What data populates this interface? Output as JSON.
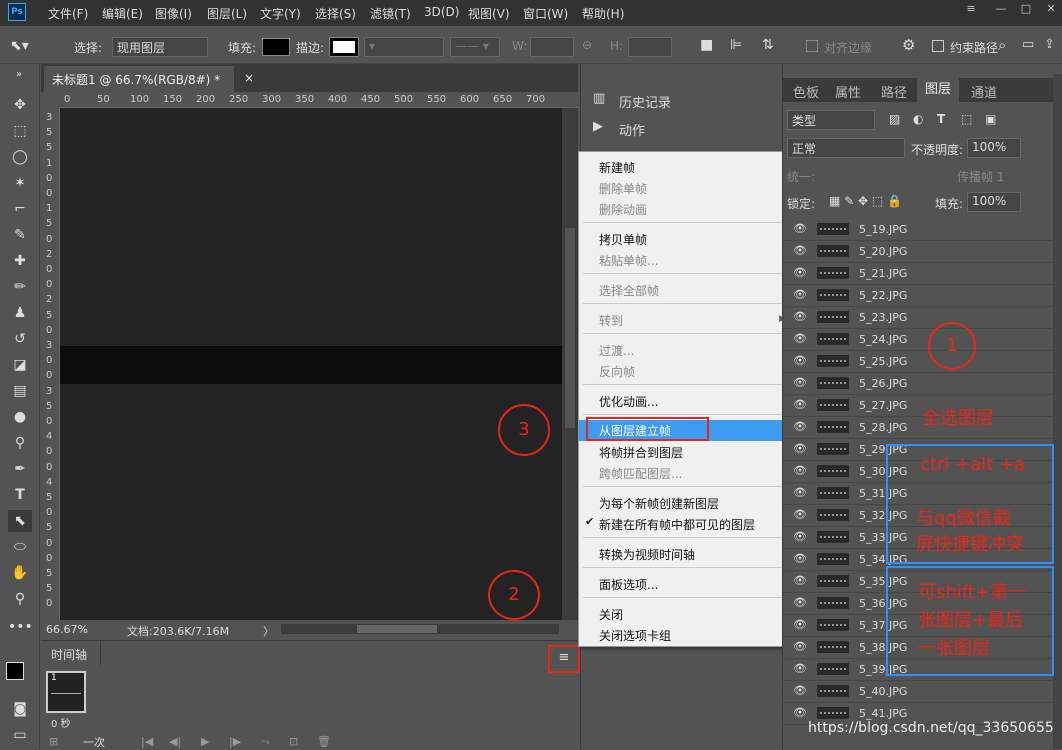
{
  "app": {
    "logo": "Ps"
  },
  "menubar": {
    "items": [
      "文件(F)",
      "编辑(E)",
      "图像(I)",
      "图层(L)",
      "文字(Y)",
      "选择(S)",
      "滤镜(T)",
      "3D(D)",
      "视图(V)",
      "窗口(W)",
      "帮助(H)"
    ]
  },
  "window_controls": {
    "collapse": "≡",
    "minimize": "—",
    "maximize": "□",
    "close": "✕"
  },
  "options": {
    "select_label": "选择:",
    "select_value": "现用图层",
    "fill_label": "填充:",
    "stroke_label": "描边:",
    "w_label": "W:",
    "h_label": "H:",
    "align_edges": "对齐边缘",
    "constrain_path": "约束路径"
  },
  "document": {
    "tab_title": "未标题1 @ 66.7%(RGB/8#) *",
    "close": "×"
  },
  "ruler": {
    "h": [
      "0",
      "50",
      "100",
      "150",
      "200",
      "250",
      "300",
      "350",
      "400",
      "450",
      "500",
      "550",
      "600",
      "650",
      "700"
    ],
    "v": [
      "3",
      "5",
      "5",
      "1",
      "0",
      "0",
      "1",
      "5",
      "0",
      "2",
      "0",
      "0",
      "2",
      "5",
      "0",
      "3",
      "0",
      "0",
      "3",
      "5",
      "0",
      "4",
      "0",
      "0",
      "4",
      "5",
      "0",
      "5",
      "0",
      "0",
      "5",
      "5",
      "0"
    ]
  },
  "status": {
    "zoom": "66.67%",
    "doc": "文档:203.6K/7.16M",
    "arrow": "〉"
  },
  "timeline": {
    "tab": "时间轴",
    "frame_number": "1",
    "frame_delay": "0 秒",
    "loop": "一次"
  },
  "mid_panel": {
    "history": "历史记录",
    "actions": "动作"
  },
  "context_menu": {
    "items": [
      {
        "label": "新建帧",
        "disabled": false
      },
      {
        "label": "删除单帧",
        "disabled": true
      },
      {
        "label": "删除动画",
        "disabled": true
      },
      {
        "label": "拷贝单帧",
        "disabled": false
      },
      {
        "label": "粘贴单帧...",
        "disabled": true
      },
      {
        "label": "选择全部帧",
        "disabled": true
      },
      {
        "label": "转到",
        "disabled": true
      },
      {
        "label": "过渡...",
        "disabled": true
      },
      {
        "label": "反向帧",
        "disabled": true
      },
      {
        "label": "优化动画...",
        "disabled": false
      },
      {
        "label": "从图层建立帧",
        "disabled": false
      },
      {
        "label": "将帧拼合到图层",
        "disabled": false
      },
      {
        "label": "跨帧匹配图层...",
        "disabled": true
      },
      {
        "label": "为每个新帧创建新图层",
        "disabled": false
      },
      {
        "label": "新建在所有帧中都可见的图层",
        "disabled": false
      },
      {
        "label": "转换为视频时间轴",
        "disabled": false
      },
      {
        "label": "面板选项...",
        "disabled": false
      },
      {
        "label": "关闭",
        "disabled": false
      },
      {
        "label": "关闭选项卡组",
        "disabled": false
      }
    ]
  },
  "layers_panel": {
    "tabs": [
      "色板",
      "属性",
      "路径",
      "图层",
      "通道"
    ],
    "active_tab": "图层",
    "filter": "类型",
    "blend_mode": "正常",
    "opacity_label": "不透明度:",
    "opacity": "100%",
    "lock_label": "锁定:",
    "fill_label": "填充:",
    "fill": "100%",
    "propagate": "传播帧 1",
    "unify": "统一:"
  },
  "layers": [
    "5_19.JPG",
    "5_20.JPG",
    "5_21.JPG",
    "5_22.JPG",
    "5_23.JPG",
    "5_24.JPG",
    "5_25.JPG",
    "5_26.JPG",
    "5_27.JPG",
    "5_28.JPG",
    "5_29.JPG",
    "5_30.JPG",
    "5_31.JPG",
    "5_32.JPG",
    "5_33.JPG",
    "5_34.JPG",
    "5_35.JPG",
    "5_36.JPG",
    "5_37.JPG",
    "5_38.JPG",
    "5_39.JPG",
    "5_40.JPG",
    "5_41.JPG"
  ],
  "annotations": {
    "c1": "1",
    "c2": "2",
    "c3": "3",
    "select_all": "全选图层",
    "shortcut": "ctrl +alt +a",
    "conflict1": "与qq微信截",
    "conflict2": "屏快捷键冲突",
    "alt1": "可shift+第一",
    "alt2": "张图层+最后",
    "alt3": "一张图层"
  },
  "watermark": "https://blog.csdn.net/qq_33650655",
  "colors": {
    "accent": "#3d9bf0",
    "annotation": "#e8261a",
    "annotation_box": "#2e8fff"
  }
}
